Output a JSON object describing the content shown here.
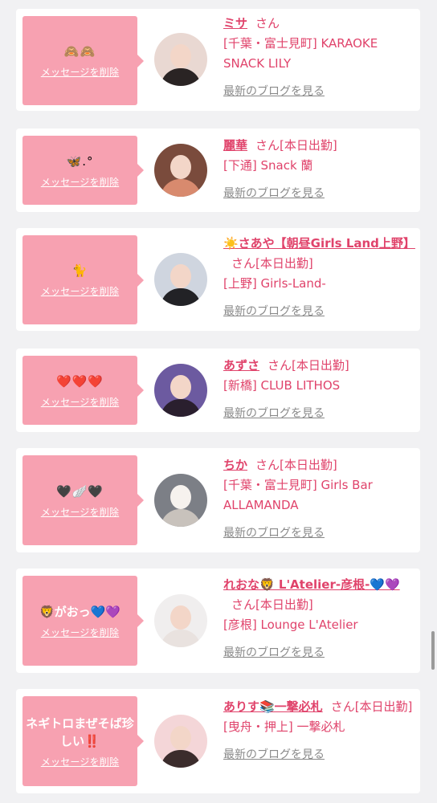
{
  "delete_label": "メッセージを削除",
  "blog_label": "最新のブログを見る",
  "entries": [
    {
      "message": "🙈🙈",
      "name": "ミサ",
      "suffix": "さん",
      "shop": "[千葉・富士見町] KARAOKE SNACK LILY",
      "avatar_colors": [
        "#e9d8d2",
        "#2a2424"
      ]
    },
    {
      "message": "🦋.°",
      "name": "麗華",
      "suffix": "さん[本日出勤]",
      "shop": "[下通] Snack 蘭",
      "avatar_colors": [
        "#7a4b3c",
        "#d88a6e"
      ]
    },
    {
      "message": "🐈",
      "name": "☀️さあや【朝昼Girls Land上野】",
      "suffix": "さん[本日出勤]",
      "shop": "[上野] Girls-Land-",
      "avatar_colors": [
        "#cfd5df",
        "#222226"
      ]
    },
    {
      "message": "❤️❤️❤️",
      "name": "あずさ",
      "suffix": "さん[本日出勤]",
      "shop": "[新橋] CLUB LITHOS",
      "avatar_colors": [
        "#6c5aa0",
        "#2a1f2e"
      ]
    },
    {
      "message": "🖤🪽🖤",
      "name": "ちか",
      "suffix": "さん[本日出勤]",
      "shop": "[千葉・富士見町] Girls Bar ALLAMANDA",
      "avatar_colors": [
        "#7c7f86",
        "#c8c2bc"
      ]
    },
    {
      "message": "🦁がおっ💙💜",
      "name": "れおな🦁 L'Atelier-彦根-💙💜",
      "suffix": "さん[本日出勤]",
      "shop": "[彦根] Lounge L'Atelier",
      "avatar_colors": [
        "#f0eeee",
        "#e9e2df"
      ]
    },
    {
      "message": "ネギトロまぜそば珍しい‼️",
      "name": "ありす📚一撃必札",
      "suffix": "さん[本日出勤]",
      "shop": "[曳舟・押上] 一撃必札",
      "avatar_colors": [
        "#f4d6d8",
        "#3b2c2c"
      ]
    }
  ]
}
